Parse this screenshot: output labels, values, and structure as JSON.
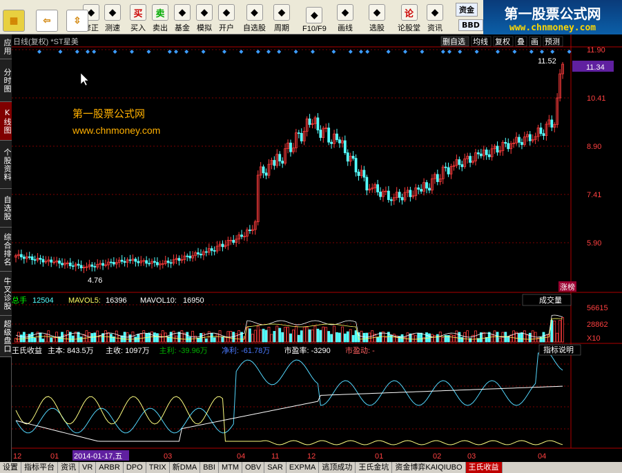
{
  "toolbar": {
    "buttons": [
      {
        "label": "修正",
        "icon": "up-down-arrow-icon"
      },
      {
        "label": "测速",
        "icon": "clock-icon"
      },
      {
        "label": "买入",
        "icon": "buy-icon",
        "glyph": "买"
      },
      {
        "label": "卖出",
        "icon": "sell-icon",
        "glyph": "卖"
      },
      {
        "label": "基金",
        "icon": "fund-icon"
      },
      {
        "label": "模拟",
        "icon": "hammer-icon"
      },
      {
        "label": "开户",
        "icon": "lock-icon"
      },
      {
        "label": "自选股",
        "icon": "star-icon"
      },
      {
        "label": "周期",
        "icon": "cycle-icon"
      },
      {
        "label": "F10/F9",
        "icon": "f10-icon"
      },
      {
        "label": "画线",
        "icon": "pen-icon"
      },
      {
        "label": "选股",
        "icon": "select-stock-icon"
      },
      {
        "label": "论股堂",
        "icon": "forum-icon",
        "glyph": "论"
      },
      {
        "label": "资讯",
        "icon": "news-icon"
      },
      {
        "label": "资金",
        "icon": "fund-flow-icon"
      },
      {
        "label": "BBD",
        "icon": "bbd-icon"
      }
    ]
  },
  "banner": {
    "title": "第一股票公式网",
    "url": "www.chnmoney.com"
  },
  "sidebar": [
    "应用",
    "分时图",
    "K线图",
    "个股资料",
    "自选股",
    "综合排名",
    "牛叉诊股",
    "超级盘口"
  ],
  "kline": {
    "title": "日线(复权) *ST星美",
    "menu": [
      "删自选",
      "均线",
      "复权",
      "叠",
      "画",
      "预测"
    ],
    "y_ticks": [
      "11.90",
      "10.41",
      "8.90",
      "7.41",
      "5.90"
    ],
    "current_price": "11.34",
    "high_label": "11.52",
    "low_label": "4.76",
    "badge": "涨榜",
    "watermark_title": "第一股票公式网",
    "watermark_url": "www.chnmoney.com"
  },
  "volume": {
    "label": "总手",
    "value": "12504",
    "mavol5_label": "MAVOL5:",
    "mavol5": "16396",
    "mavol10_label": "MAVOL10:",
    "mavol10": "16950",
    "dropdown": "成交量",
    "y_ticks": [
      "56615",
      "28862",
      "X10"
    ]
  },
  "indicator": {
    "name": "王氏收益",
    "items": [
      {
        "label": "主本:",
        "value": "843.5万",
        "color": "#ffffff"
      },
      {
        "label": "主收:",
        "value": "1097万",
        "color": "#ffffff"
      },
      {
        "label": "主利:",
        "value": "-39.96万",
        "color": "#00b000"
      },
      {
        "label": "净利:",
        "value": "-61.78万",
        "color": "#4a7aff"
      },
      {
        "label": "市盈率:",
        "value": "-3290",
        "color": "#ffffff"
      },
      {
        "label": "市盈动:",
        "value": "-",
        "color": "#ff6060"
      }
    ],
    "help": "指标说明"
  },
  "x_axis": {
    "labels": [
      "12",
      "01",
      "2014-01-17,五",
      "03",
      "04",
      "11",
      "12",
      "01",
      "02",
      "03",
      "04"
    ]
  },
  "bottom_tabs": [
    "设置",
    "指标平台",
    "资讯",
    "VR",
    "ARBR",
    "DPO",
    "TRIX",
    "新DMA",
    "BBI",
    "MTM",
    "OBV",
    "SAR",
    "EXPMA",
    "逃顶成功",
    "王氏金坑",
    "资金博弈KAIQIUBO",
    "王氏收益"
  ],
  "colors": {
    "up": "#ff3c3c",
    "down": "#54ffff",
    "grid": "#800000",
    "axis": "#b00000"
  }
}
